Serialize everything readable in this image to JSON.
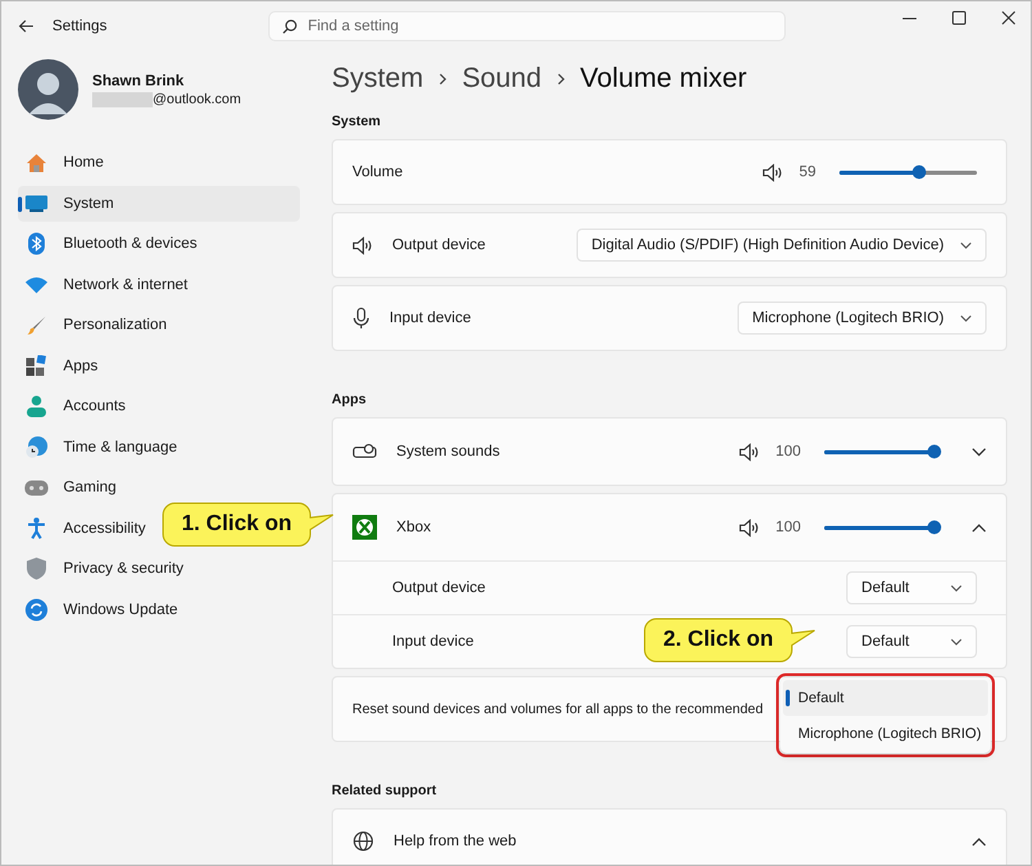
{
  "window": {
    "title": "Settings"
  },
  "search": {
    "placeholder": "Find a setting"
  },
  "account": {
    "name": "Shawn Brink",
    "email": "@outlook.com"
  },
  "sidebar": {
    "items": [
      {
        "label": "Home",
        "selected": false
      },
      {
        "label": "System",
        "selected": true
      },
      {
        "label": "Bluetooth & devices",
        "selected": false
      },
      {
        "label": "Network & internet",
        "selected": false
      },
      {
        "label": "Personalization",
        "selected": false
      },
      {
        "label": "Apps",
        "selected": false
      },
      {
        "label": "Accounts",
        "selected": false
      },
      {
        "label": "Time & language",
        "selected": false
      },
      {
        "label": "Gaming",
        "selected": false
      },
      {
        "label": "Accessibility",
        "selected": false
      },
      {
        "label": "Privacy & security",
        "selected": false
      },
      {
        "label": "Windows Update",
        "selected": false
      }
    ]
  },
  "breadcrumb": [
    "System",
    "Sound",
    "Volume mixer"
  ],
  "system": {
    "heading": "System",
    "volume": {
      "label": "Volume",
      "reading": "59",
      "level": 0.58
    },
    "output_device": {
      "label": "Output device",
      "value": "Digital Audio (S/PDIF) (High Definition Audio Device)"
    },
    "input_device": {
      "label": "Input device",
      "value": "Microphone (Logitech BRIO)"
    }
  },
  "apps": {
    "heading": "Apps",
    "items": [
      {
        "name": "System sounds",
        "reading": "100",
        "level": 1,
        "expanded": false
      },
      {
        "name": "Xbox",
        "reading": "100",
        "level": 1,
        "expanded": true,
        "output_device": {
          "label": "Output device",
          "value": "Default"
        },
        "input_device": {
          "label": "Input device",
          "value": "Default"
        }
      }
    ],
    "reset": {
      "text": "Reset sound devices and volumes for all apps to the recommended"
    }
  },
  "dropdown": {
    "options": [
      {
        "label": "Default",
        "selected": true
      },
      {
        "label": "Microphone (Logitech BRIO)",
        "selected": false
      }
    ]
  },
  "related_support": {
    "heading": "Related support",
    "items": [
      {
        "label": "Help from the web",
        "expanded": true
      }
    ]
  },
  "callouts": [
    {
      "text": "1. Click on"
    },
    {
      "text": "2. Click on"
    }
  ]
}
